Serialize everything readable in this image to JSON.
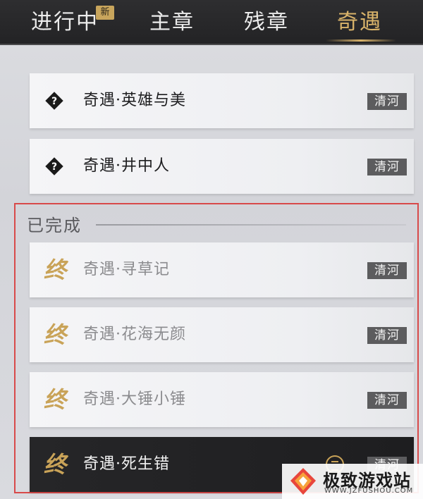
{
  "tabs": [
    {
      "label": "进行中",
      "badge": "新"
    },
    {
      "label": "主章"
    },
    {
      "label": "残章"
    },
    {
      "label": "奇遇",
      "active": true
    }
  ],
  "quests_active": [
    {
      "title": "奇遇·英雄与美",
      "location": "清河",
      "icon": "diamond-question-icon"
    },
    {
      "title": "奇遇·井中人",
      "location": "清河",
      "icon": "diamond-question-icon"
    }
  ],
  "completed": {
    "label": "已完成",
    "items": [
      {
        "title": "奇遇·寻草记",
        "location": "清河",
        "mark": "终"
      },
      {
        "title": "奇遇·花海无颜",
        "location": "清河",
        "mark": "终"
      },
      {
        "title": "奇遇·大锤小锤",
        "location": "清河",
        "mark": "终"
      },
      {
        "title": "奇遇·死生错",
        "location": "清河",
        "mark": "终"
      }
    ]
  },
  "watermark": {
    "name": "极致游戏站",
    "url": "WWW.JZFUSHOU.COM"
  },
  "colors": {
    "accent_gold": "#d9b36a",
    "highlight_box": "#d84a4a",
    "tab_bar": "#2a2a2c"
  }
}
